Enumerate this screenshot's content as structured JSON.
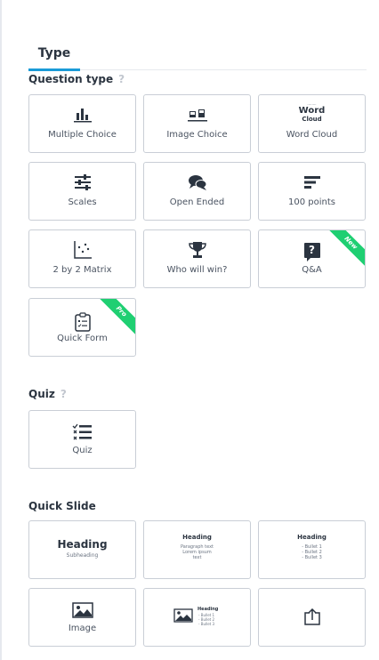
{
  "tabs": [
    {
      "label": "Type"
    }
  ],
  "sections": {
    "question_type": {
      "title": "Question type",
      "help": "?"
    },
    "quiz": {
      "title": "Quiz",
      "help": "?"
    },
    "quick_slide": {
      "title": "Quick Slide"
    }
  },
  "question_types": [
    {
      "label": "Multiple Choice",
      "icon": "bar-chart-icon"
    },
    {
      "label": "Image Choice",
      "icon": "image-choice-icon"
    },
    {
      "label": "Word Cloud",
      "icon": "word-cloud-icon",
      "icon_text": [
        "Word",
        "Cloud"
      ]
    },
    {
      "label": "Scales",
      "icon": "sliders-icon"
    },
    {
      "label": "Open Ended",
      "icon": "speech-bubbles-icon"
    },
    {
      "label": "100 points",
      "icon": "bars-horizontal-icon"
    },
    {
      "label": "2 by 2 Matrix",
      "icon": "scatter-matrix-icon"
    },
    {
      "label": "Who will win?",
      "icon": "trophy-icon"
    },
    {
      "label": "Q&A",
      "icon": "question-box-icon",
      "icon_text": "?",
      "badge": "New"
    },
    {
      "label": "Quick Form",
      "icon": "clipboard-icon",
      "badge": "Pro"
    }
  ],
  "quiz": [
    {
      "label": "Quiz",
      "icon": "quiz-list-icon"
    }
  ],
  "quick_slides": [
    {
      "heading": "Heading",
      "subheading": "Subheading"
    },
    {
      "heading": "Heading",
      "lines": [
        "Paragraph text",
        "Lorem ipsum",
        "text"
      ]
    },
    {
      "heading": "Heading",
      "lines": [
        "- Bullet 1",
        "- Bullet 2",
        "- Bullet 3"
      ]
    },
    {
      "label": "Image",
      "icon": "image-icon"
    },
    {
      "heading": "Heading",
      "lines": [
        "- Bullet 1",
        "- Bullet 2",
        "- Bullet 3"
      ],
      "icon": "image-icon"
    },
    {
      "icon": "embed-icon"
    }
  ],
  "colors": {
    "accent": "#1a9bd7",
    "badge": "#1fcf72",
    "icon": "#2b3440",
    "border": "#c9ced6"
  }
}
